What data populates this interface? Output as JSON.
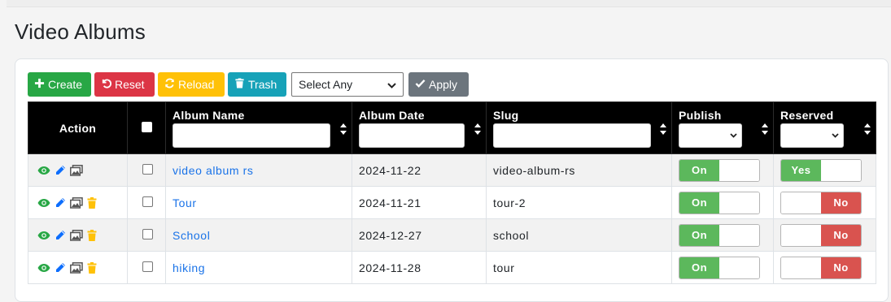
{
  "page": {
    "title": "Video Albums"
  },
  "toolbar": {
    "create_label": "Create",
    "reset_label": "Reset",
    "reload_label": "Reload",
    "trash_label": "Trash",
    "select_value": "Select Any",
    "apply_label": "Apply"
  },
  "table": {
    "columns": [
      "Action",
      "Album Name",
      "Album Date",
      "Slug",
      "Publish",
      "Reserved"
    ],
    "rows": [
      {
        "name": "video album rs",
        "date": "2024-11-22",
        "slug": "video-album-rs",
        "publish": "On",
        "reserved": "Yes",
        "has_delete": false
      },
      {
        "name": "Tour",
        "date": "2024-11-21",
        "slug": "tour-2",
        "publish": "On",
        "reserved": "No",
        "has_delete": true
      },
      {
        "name": "School",
        "date": "2024-12-27",
        "slug": "school",
        "publish": "On",
        "reserved": "No",
        "has_delete": true
      },
      {
        "name": "hiking",
        "date": "2024-11-28",
        "slug": "tour",
        "publish": "On",
        "reserved": "No",
        "has_delete": true
      }
    ]
  },
  "colors": {
    "create": "#28a745",
    "reset": "#dc3545",
    "reload": "#ffc107",
    "trash": "#17a2b8",
    "apply": "#6c757d",
    "toggle_on": "#5cb85c",
    "toggle_off": "#d9534f",
    "link": "#1a73e8"
  },
  "icons": [
    "plus-icon",
    "undo-icon",
    "refresh-icon",
    "trash-icon",
    "check-icon",
    "eye-icon",
    "pencil-icon",
    "images-icon",
    "delete-icon",
    "sort-icon",
    "chevron-down-icon"
  ]
}
